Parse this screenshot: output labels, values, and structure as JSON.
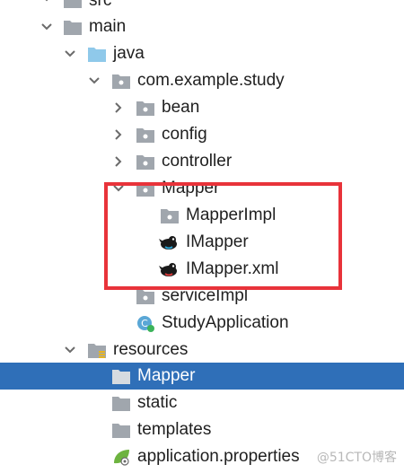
{
  "tree": {
    "items": [
      {
        "label": "src"
      },
      {
        "label": "main"
      },
      {
        "label": "java"
      },
      {
        "label": "com.example.study"
      },
      {
        "label": "bean"
      },
      {
        "label": "config"
      },
      {
        "label": "controller"
      },
      {
        "label": "Mapper"
      },
      {
        "label": "MapperImpl"
      },
      {
        "label": "IMapper"
      },
      {
        "label": "IMapper.xml"
      },
      {
        "label": "serviceImpl"
      },
      {
        "label": "StudyApplication"
      },
      {
        "label": "resources"
      },
      {
        "label": "Mapper"
      },
      {
        "label": "static"
      },
      {
        "label": "templates"
      },
      {
        "label": "application.properties"
      }
    ],
    "selected_index": 14,
    "colors": {
      "selection": "#2f6fb8",
      "folder": "#a0a6ad",
      "source_folder": "#8fc9ea",
      "highlight_box": "#e8333a"
    }
  },
  "watermark": "@51CTO博客"
}
